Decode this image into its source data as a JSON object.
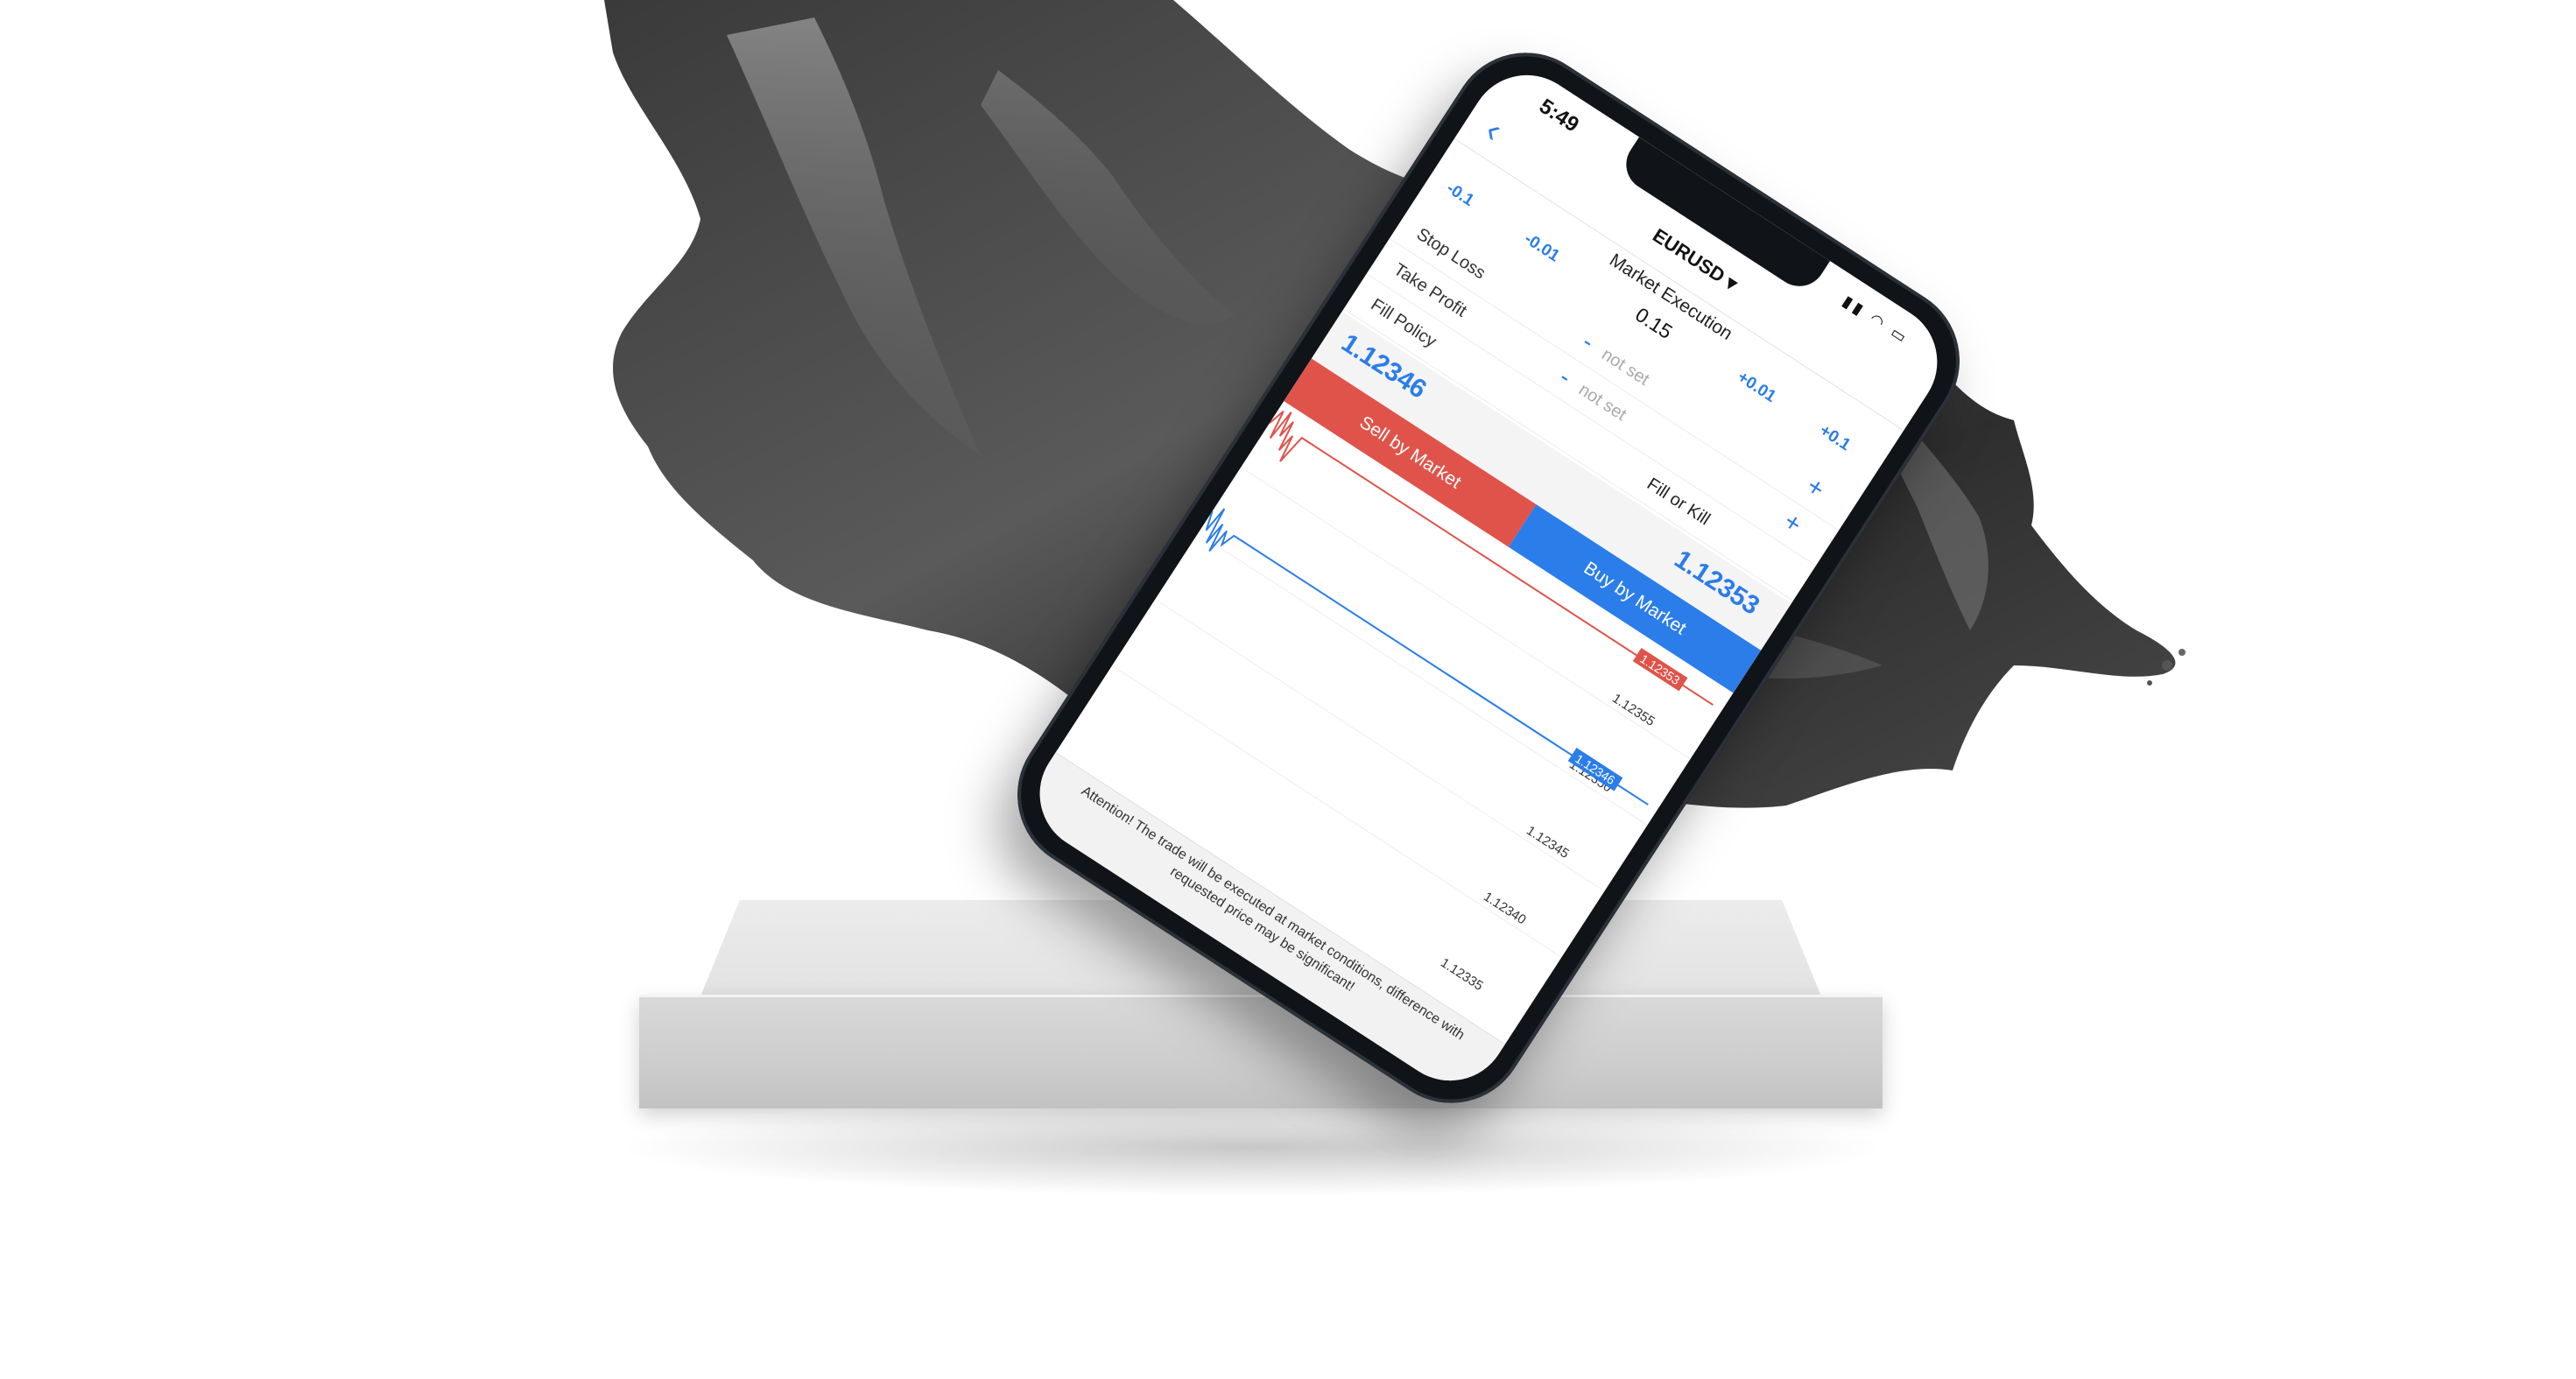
{
  "status_bar": {
    "time": "5:49"
  },
  "nav": {
    "back_icon": "chevron-left-icon",
    "symbol": "EURUSD",
    "symbol_caret": "▾"
  },
  "order": {
    "execution": "Market Execution",
    "steps": [
      "-0.1",
      "-0.01",
      "+0.01",
      "+0.1"
    ],
    "volume": "0.15",
    "stop_loss_label": "Stop Loss",
    "take_profit_label": "Take Profit",
    "fill_policy_label": "Fill Policy",
    "stop_loss_value": "not set",
    "take_profit_value": "not set",
    "fill_policy_value": "Fill or Kill",
    "minus": "-",
    "plus": "+"
  },
  "prices": {
    "bid": "1.12346",
    "ask": "1.12353",
    "sell_label": "Sell by Market",
    "buy_label": "Buy by Market"
  },
  "chart": {
    "ticks": [
      "1.12355",
      "1.12350",
      "1.12345",
      "1.12340",
      "1.12335"
    ],
    "ask_tag": "1.12353",
    "bid_tag": "1.12346",
    "colors": {
      "ask": "#e0534a",
      "bid": "#2b7de9"
    }
  },
  "warning": "Attention! The trade will be executed at market conditions, difference with requested price may be significant!"
}
